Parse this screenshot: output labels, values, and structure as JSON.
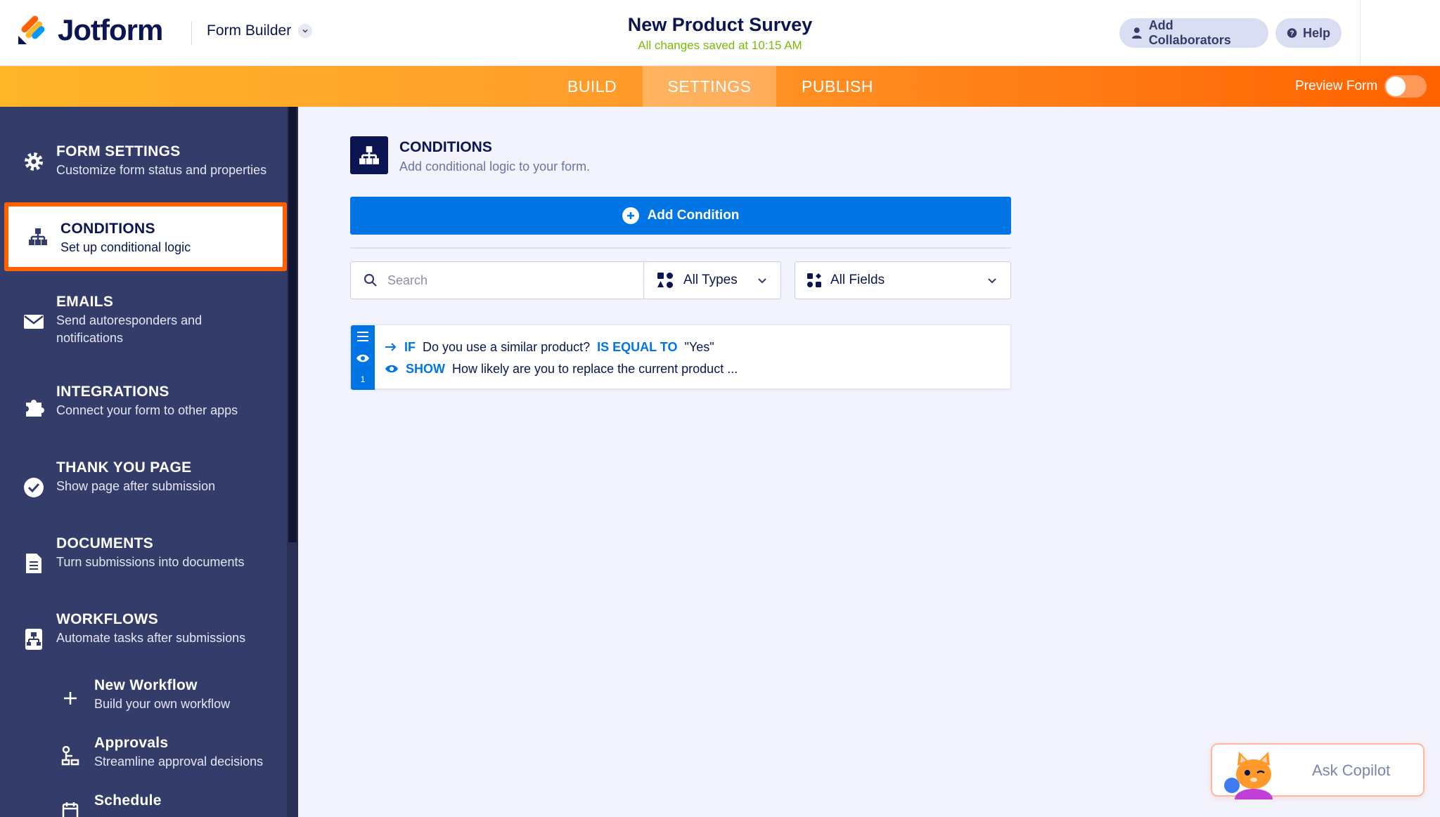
{
  "header": {
    "logo_text": "Jotform",
    "builder_label": "Form Builder",
    "form_title": "New Product Survey",
    "save_status": "All changes saved at 10:15 AM",
    "collaborators_label": "Add Collaborators",
    "help_label": "Help"
  },
  "tabs": {
    "items": [
      {
        "label": "BUILD",
        "active": false
      },
      {
        "label": "SETTINGS",
        "active": true
      },
      {
        "label": "PUBLISH",
        "active": false
      }
    ],
    "preview_label": "Preview Form",
    "preview_on": false
  },
  "sidebar": {
    "items": [
      {
        "title": "FORM SETTINGS",
        "subtitle": "Customize form status and properties",
        "icon": "gear-icon"
      },
      {
        "title": "CONDITIONS",
        "subtitle": "Set up conditional logic",
        "icon": "conditions-icon",
        "active": true
      },
      {
        "title": "EMAILS",
        "subtitle": "Send autoresponders and notifications",
        "icon": "envelope-icon"
      },
      {
        "title": "INTEGRATIONS",
        "subtitle": "Connect your form to other apps",
        "icon": "puzzle-icon"
      },
      {
        "title": "THANK YOU PAGE",
        "subtitle": "Show page after submission",
        "icon": "check-circle-icon"
      },
      {
        "title": "DOCUMENTS",
        "subtitle": "Turn submissions into documents",
        "icon": "document-icon"
      },
      {
        "title": "WORKFLOWS",
        "subtitle": "Automate tasks after submissions",
        "icon": "workflow-icon"
      }
    ],
    "subitems": [
      {
        "title": "New Workflow",
        "subtitle": "Build your own workflow",
        "icon": "plus-icon"
      },
      {
        "title": "Approvals",
        "subtitle": "Streamline approval decisions",
        "icon": "approval-icon"
      },
      {
        "title": "Schedule",
        "subtitle": "",
        "icon": "calendar-icon"
      }
    ]
  },
  "main": {
    "section_title": "CONDITIONS",
    "section_subtitle": "Add conditional logic to your form.",
    "add_button": "Add Condition",
    "search_placeholder": "Search",
    "types_filter": "All Types",
    "fields_filter": "All Fields",
    "conditions": [
      {
        "number": "1",
        "if_keyword": "IF",
        "if_field": "Do you use a similar product?",
        "operator": "IS EQUAL TO",
        "value": "\"Yes\"",
        "action_keyword": "SHOW",
        "action_target": "How likely are you to replace the current product ..."
      }
    ]
  },
  "copilot": {
    "label": "Ask Copilot"
  },
  "colors": {
    "navy": "#0a1551",
    "orange": "#ff6100",
    "blue": "#0075e3",
    "sidebar_bg": "#343c6a",
    "saved_green": "#78bb07"
  }
}
